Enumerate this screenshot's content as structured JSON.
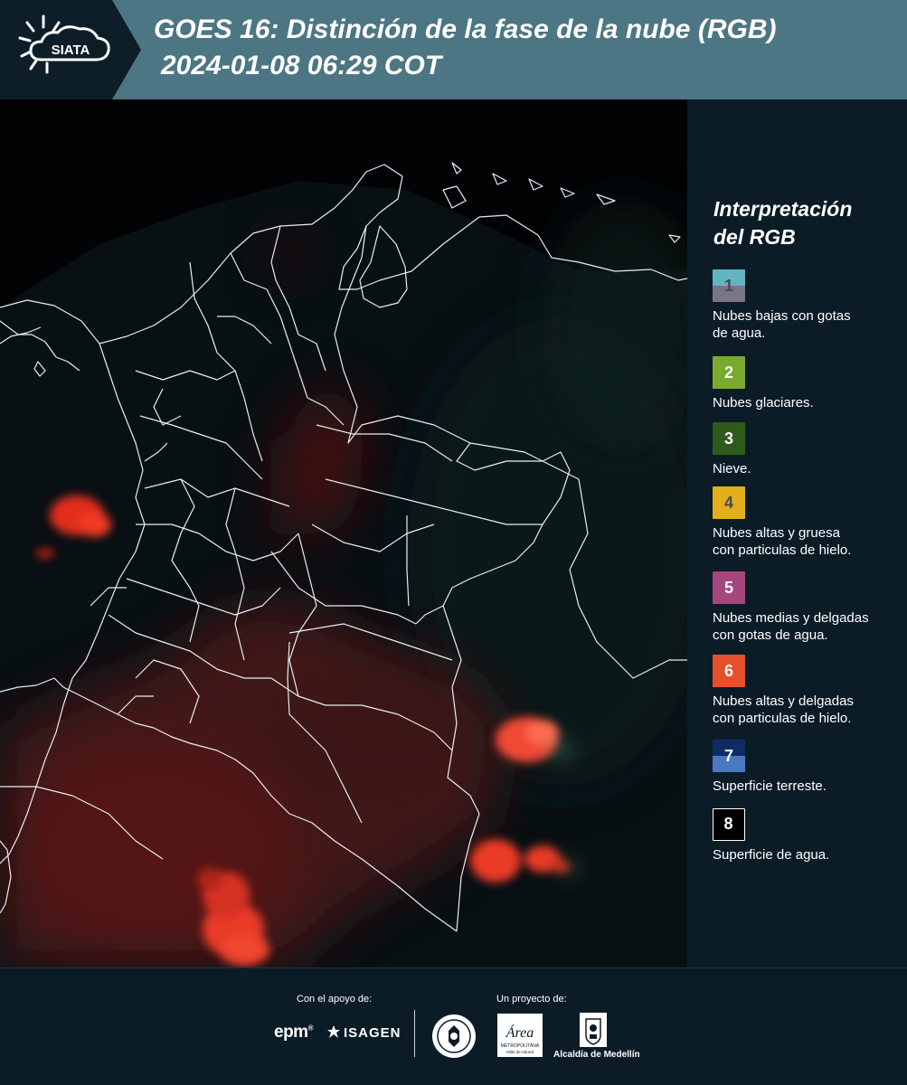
{
  "header": {
    "logo_text": "SIATA",
    "title_line1": "GOES 16: Distinción de la fase de la nube (RGB)",
    "title_line2": "2024-01-08 06:29 COT"
  },
  "legend": {
    "title_line1": "Interpretación",
    "title_line2": "del RGB",
    "items": [
      {
        "number": "1",
        "label_line1": "Nubes bajas con gotas",
        "label_line2": "de agua.",
        "color_top": "#62b4c3",
        "color_bottom": "#7a7488",
        "number_color": "#4a4a55"
      },
      {
        "number": "2",
        "label_line1": "Nubes glaciares.",
        "label_line2": "",
        "color_top": "#7aaa2e",
        "color_bottom": "#7aaa2e",
        "number_color": "#ffffff"
      },
      {
        "number": "3",
        "label_line1": "Nieve.",
        "label_line2": "",
        "color_top": "#2e5a1c",
        "color_bottom": "#2e5a1c",
        "number_color": "#ffffff"
      },
      {
        "number": "4",
        "label_line1": "Nubes altas y gruesa",
        "label_line2": "con particulas de hielo.",
        "color_top": "#e2ae1c",
        "color_bottom": "#e2ae1c",
        "number_color": "#4a4a4a"
      },
      {
        "number": "5",
        "label_line1": "Nubes medias y delgadas",
        "label_line2": "con gotas de agua.",
        "color_top": "#a6467e",
        "color_bottom": "#a6467e",
        "number_color": "#ffffff"
      },
      {
        "number": "6",
        "label_line1": "Nubes altas y delgadas",
        "label_line2": "con particulas de hielo.",
        "color_top": "#e5502a",
        "color_bottom": "#e5502a",
        "number_color": "#ffffff"
      },
      {
        "number": "7",
        "label_line1": "Superficie terreste.",
        "label_line2": "",
        "color_top": "#0f2c66",
        "color_bottom": "#4a78c2",
        "number_color": "#ffffff"
      },
      {
        "number": "8",
        "label_line1": "Superficie de agua.",
        "label_line2": "",
        "color_top": "#000000",
        "color_bottom": "#000000",
        "number_color": "#ffffff"
      }
    ]
  },
  "footer": {
    "support_label": "Con el apoyo de:",
    "project_label": "Un proyecto de:",
    "sponsor_epm": "epm",
    "sponsor_isagen": "ISAGEN",
    "area_logo_text": "Área",
    "area_logo_sub": "METROPOLITANA",
    "area_logo_sub2": "Valle de Aburrá",
    "alcaldia": "Alcaldía de Medellín"
  }
}
